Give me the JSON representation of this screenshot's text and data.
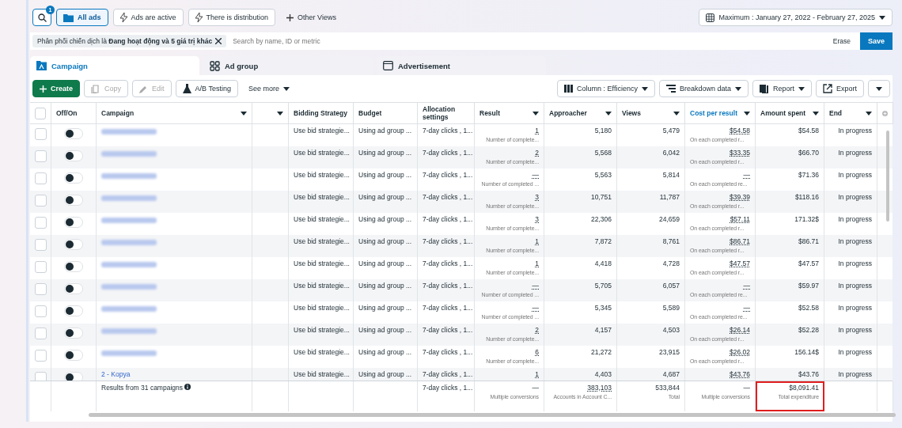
{
  "view_bar": {
    "search_badge": "1",
    "views": [
      {
        "label": "All ads",
        "kind": "folder",
        "selected": true
      },
      {
        "label": "Ads are active",
        "kind": "bolt",
        "selected": false
      },
      {
        "label": "There is distribution",
        "kind": "bolt",
        "selected": false
      },
      {
        "label": "Other Views",
        "kind": "plus",
        "selected": false
      }
    ],
    "date_range": "Maximum : January 27, 2022 - February 27, 2025"
  },
  "filter": {
    "chip_prefix": "Phân phối chiến dịch là",
    "chip_value": "Đang hoạt động và 5 giá trị khác",
    "placeholder": "Search by name, ID or metric",
    "erase": "Erase",
    "save": "Save"
  },
  "tabs": [
    {
      "label": "Campaign",
      "kind": "campaign",
      "selected": true
    },
    {
      "label": "Ad group",
      "kind": "adgroup",
      "selected": false
    },
    {
      "label": "Advertisement",
      "kind": "ad",
      "selected": false
    }
  ],
  "toolbar": {
    "left": [
      {
        "label": "Create",
        "kind": "primary",
        "disabled": false
      },
      {
        "label": "Copy",
        "kind": "copy",
        "disabled": true
      },
      {
        "label": "Edit",
        "kind": "edit",
        "disabled": true
      },
      {
        "label": "A/B Testing",
        "kind": "flask",
        "disabled": false
      },
      {
        "label": "See more",
        "kind": "menu",
        "disabled": false
      }
    ],
    "right": [
      {
        "label": "Column : Efficiency",
        "kind": "columns"
      },
      {
        "label": "Breakdown data",
        "kind": "breakdown"
      },
      {
        "label": "Report",
        "kind": "report"
      },
      {
        "label": "Export",
        "kind": "export"
      }
    ]
  },
  "table": {
    "select_all_checked": false,
    "columns": [
      {
        "label": "Off/On"
      },
      {
        "label": "Campaign"
      },
      {},
      {
        "label": "Bidding Strategy"
      },
      {
        "label": "Budget"
      },
      {
        "label": "Allocation settings"
      },
      {
        "label": "Result"
      },
      {
        "label": "Approacher"
      },
      {
        "label": "Views"
      },
      {
        "label": "Cost per result",
        "selected": true
      },
      {
        "label": "Amount spent"
      },
      {
        "label": "End"
      }
    ],
    "rows": [
      {
        "checked": false,
        "on": false,
        "blurred": true,
        "bidding": "Use bid strategie...",
        "budget": "Using ad group ...",
        "allocation": "7-day clicks , 1...",
        "result": "1",
        "result_note": "Number of complete...",
        "approacher": "5,180",
        "views": "5,479",
        "cost": "$54.58",
        "cost_note": "On each completed r...",
        "spent": "$54.58",
        "end": "In progress"
      },
      {
        "checked": false,
        "on": false,
        "blurred": true,
        "bidding": "Use bid strategie...",
        "budget": "Using ad group ...",
        "allocation": "7-day clicks , 1...",
        "result": "2",
        "result_note": "Number of complete...",
        "approacher": "5,568",
        "views": "6,042",
        "cost": "$33.35",
        "cost_note": "On each completed r...",
        "spent": "$66.70",
        "end": "In progress"
      },
      {
        "checked": false,
        "on": false,
        "blurred": true,
        "bidding": "Use bid strategie...",
        "budget": "Using ad group ...",
        "allocation": "7-day clicks , 1...",
        "result": "—",
        "result_note": "Number of completed ...",
        "approacher": "5,563",
        "views": "5,814",
        "cost": "—",
        "cost_note": "On each completed re...",
        "spent": "$71.36",
        "end": "In progress"
      },
      {
        "checked": false,
        "on": false,
        "blurred": true,
        "bidding": "Use bid strategie...",
        "budget": "Using ad group ...",
        "allocation": "7-day clicks , 1...",
        "result": "3",
        "result_note": "Number of complete...",
        "approacher": "10,751",
        "views": "11,787",
        "cost": "$39.39",
        "cost_note": "On each completed r...",
        "spent": "$118.16",
        "end": "In progress"
      },
      {
        "checked": false,
        "on": false,
        "blurred": true,
        "bidding": "Use bid strategie...",
        "budget": "Using ad group ...",
        "allocation": "7-day clicks , 1...",
        "result": "3",
        "result_note": "Number of complete...",
        "approacher": "22,306",
        "views": "24,659",
        "cost": "$57.11",
        "cost_note": "On each completed r...",
        "spent": "171.32$",
        "end": "In progress"
      },
      {
        "checked": false,
        "on": false,
        "blurred": true,
        "bidding": "Use bid strategie...",
        "budget": "Using ad group ...",
        "allocation": "7-day clicks , 1...",
        "result": "1",
        "result_note": "Number of complete...",
        "approacher": "7,872",
        "views": "8,761",
        "cost": "$86.71",
        "cost_note": "On each completed r...",
        "spent": "$86.71",
        "end": "In progress"
      },
      {
        "checked": false,
        "on": false,
        "blurred": true,
        "bidding": "Use bid strategie...",
        "budget": "Using ad group ...",
        "allocation": "7-day clicks , 1...",
        "result": "1",
        "result_note": "Number of complete...",
        "approacher": "4,418",
        "views": "4,728",
        "cost": "$47.57",
        "cost_note": "On each completed r...",
        "spent": "$47.57",
        "end": "In progress"
      },
      {
        "checked": false,
        "on": false,
        "blurred": true,
        "bidding": "Use bid strategie...",
        "budget": "Using ad group ...",
        "allocation": "7-day clicks , 1...",
        "result": "—",
        "result_note": "Number of completed ...",
        "approacher": "5,705",
        "views": "6,057",
        "cost": "—",
        "cost_note": "On each completed re...",
        "spent": "$59.97",
        "end": "In progress"
      },
      {
        "checked": false,
        "on": false,
        "blurred": true,
        "bidding": "Use bid strategie...",
        "budget": "Using ad group ...",
        "allocation": "7-day clicks , 1...",
        "result": "—",
        "result_note": "Number of completed ...",
        "approacher": "5,345",
        "views": "5,589",
        "cost": "—",
        "cost_note": "On each completed re...",
        "spent": "$52.58",
        "end": "In progress"
      },
      {
        "checked": false,
        "on": false,
        "blurred": true,
        "bidding": "Use bid strategie...",
        "budget": "Using ad group ...",
        "allocation": "7-day clicks , 1...",
        "result": "2",
        "result_note": "Number of complete...",
        "approacher": "4,157",
        "views": "4,503",
        "cost": "$26.14",
        "cost_note": "On each completed r...",
        "spent": "$52.28",
        "end": "In progress"
      },
      {
        "checked": false,
        "on": false,
        "blurred": true,
        "bidding": "Use bid strategie...",
        "budget": "Using ad group ...",
        "allocation": "7-day clicks , 1...",
        "result": "6",
        "result_note": "Number of complete...",
        "approacher": "21,272",
        "views": "23,915",
        "cost": "$26.02",
        "cost_note": "On each completed r...",
        "spent": "156.14$",
        "end": "In progress"
      },
      {
        "checked": false,
        "on": false,
        "blurred": false,
        "name": "2 - Kopya",
        "bidding": "Use bid strategie...",
        "budget": "Using ad group ...",
        "allocation": "7-day clicks , 1...",
        "result": "1",
        "approacher": "4,403",
        "views": "4,687",
        "cost": "$43.76",
        "spent": "$43.76",
        "end": "In progress"
      }
    ],
    "summary": {
      "label": "Results from 31 campaigns",
      "allocation": "7-day clicks , 1...",
      "result": "—",
      "result_note": "Multiple conversions",
      "approacher": "383,103",
      "approacher_note": "Accounts in Account C...",
      "views": "533,844",
      "views_note": "Total",
      "cost": "—",
      "cost_note": "Multiple conversions",
      "spent": "$8,091.41",
      "spent_note": "Total expenditure",
      "spent_highlighted": true
    }
  }
}
